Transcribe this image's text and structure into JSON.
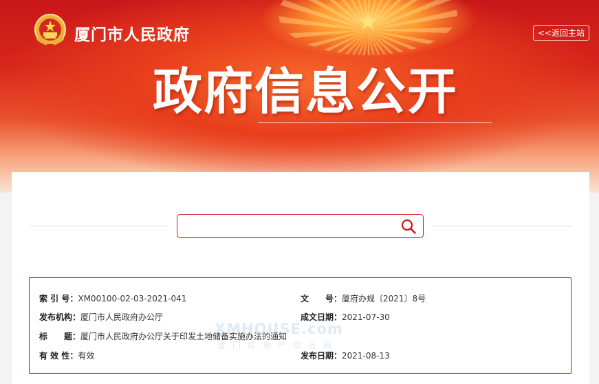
{
  "header": {
    "site_title": "厦门市人民政府",
    "back_label": "<<返回主站",
    "hero_title": "政府信息公开"
  },
  "search": {
    "value": "",
    "placeholder": ""
  },
  "info": {
    "index_label": "索 引 号：",
    "index_value": "XM00100-02-03-2021-041",
    "docno_label": "文　　号：",
    "docno_value": "厦府办规〔2021〕8号",
    "publisher_label": "发布机构：",
    "publisher_value": "厦门市人民政府办公厅",
    "created_label": "成文日期：",
    "created_value": "2021-07-30",
    "title_label": "标　　题：",
    "title_value": "厦门市人民政府办公厅关于印发土地储备实施办法的通知",
    "validity_label": "有 效 性：",
    "validity_value": "有效",
    "published_label": "发布日期：",
    "published_value": "2021-08-13"
  },
  "watermark": {
    "top": "XMHOUSE.com",
    "bottom": "厦门房地产联合网"
  },
  "icons": {
    "emblem": "national-emblem-icon",
    "search": "search-icon",
    "star": "star-icon"
  },
  "colors": {
    "accent": "#c8161d",
    "banner_red": "#d8261b",
    "gold": "#f7c564"
  }
}
